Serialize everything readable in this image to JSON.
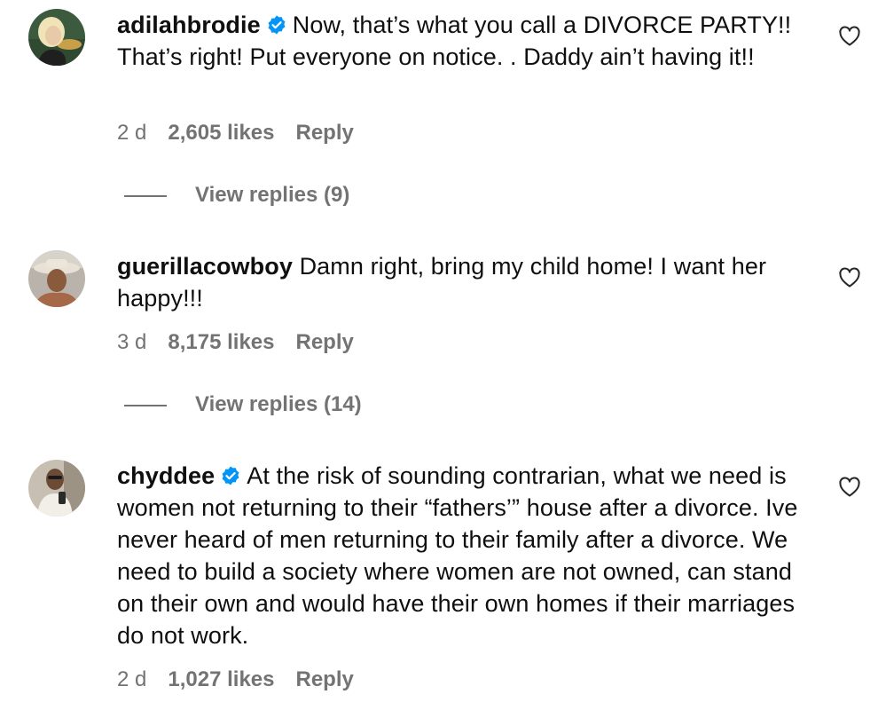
{
  "comments": [
    {
      "username": "adilahbrodie",
      "verified": true,
      "text": "Now, that’s what you call a DIVORCE PARTY!! That’s right! Put everyone on notice. . Daddy ain’t having it!!",
      "time": "2 d",
      "likes": "2,605 likes",
      "reply": "Reply",
      "view_replies": "View replies (9)"
    },
    {
      "username": "guerillacowboy",
      "verified": false,
      "text": "Damn right, bring my child home! I want her happy!!!",
      "time": "3 d",
      "likes": "8,175 likes",
      "reply": "Reply",
      "view_replies": "View replies (14)"
    },
    {
      "username": "chyddee",
      "verified": true,
      "text": "At the risk of sounding contrarian, what we need is women not returning to their “fathers’” house after a divorce. Ive never heard of men returning to their family after a divorce. We need to build a society where women are not owned, can stand on their own and would have their own homes if their marriages do not work.",
      "time": "2 d",
      "likes": "1,027 likes",
      "reply": "Reply"
    }
  ],
  "icons": {
    "verified": "verified-badge-icon",
    "like": "heart-outline-icon"
  },
  "colors": {
    "verified": "#0095f6",
    "meta": "#737373",
    "text": "#0f0f0f"
  }
}
